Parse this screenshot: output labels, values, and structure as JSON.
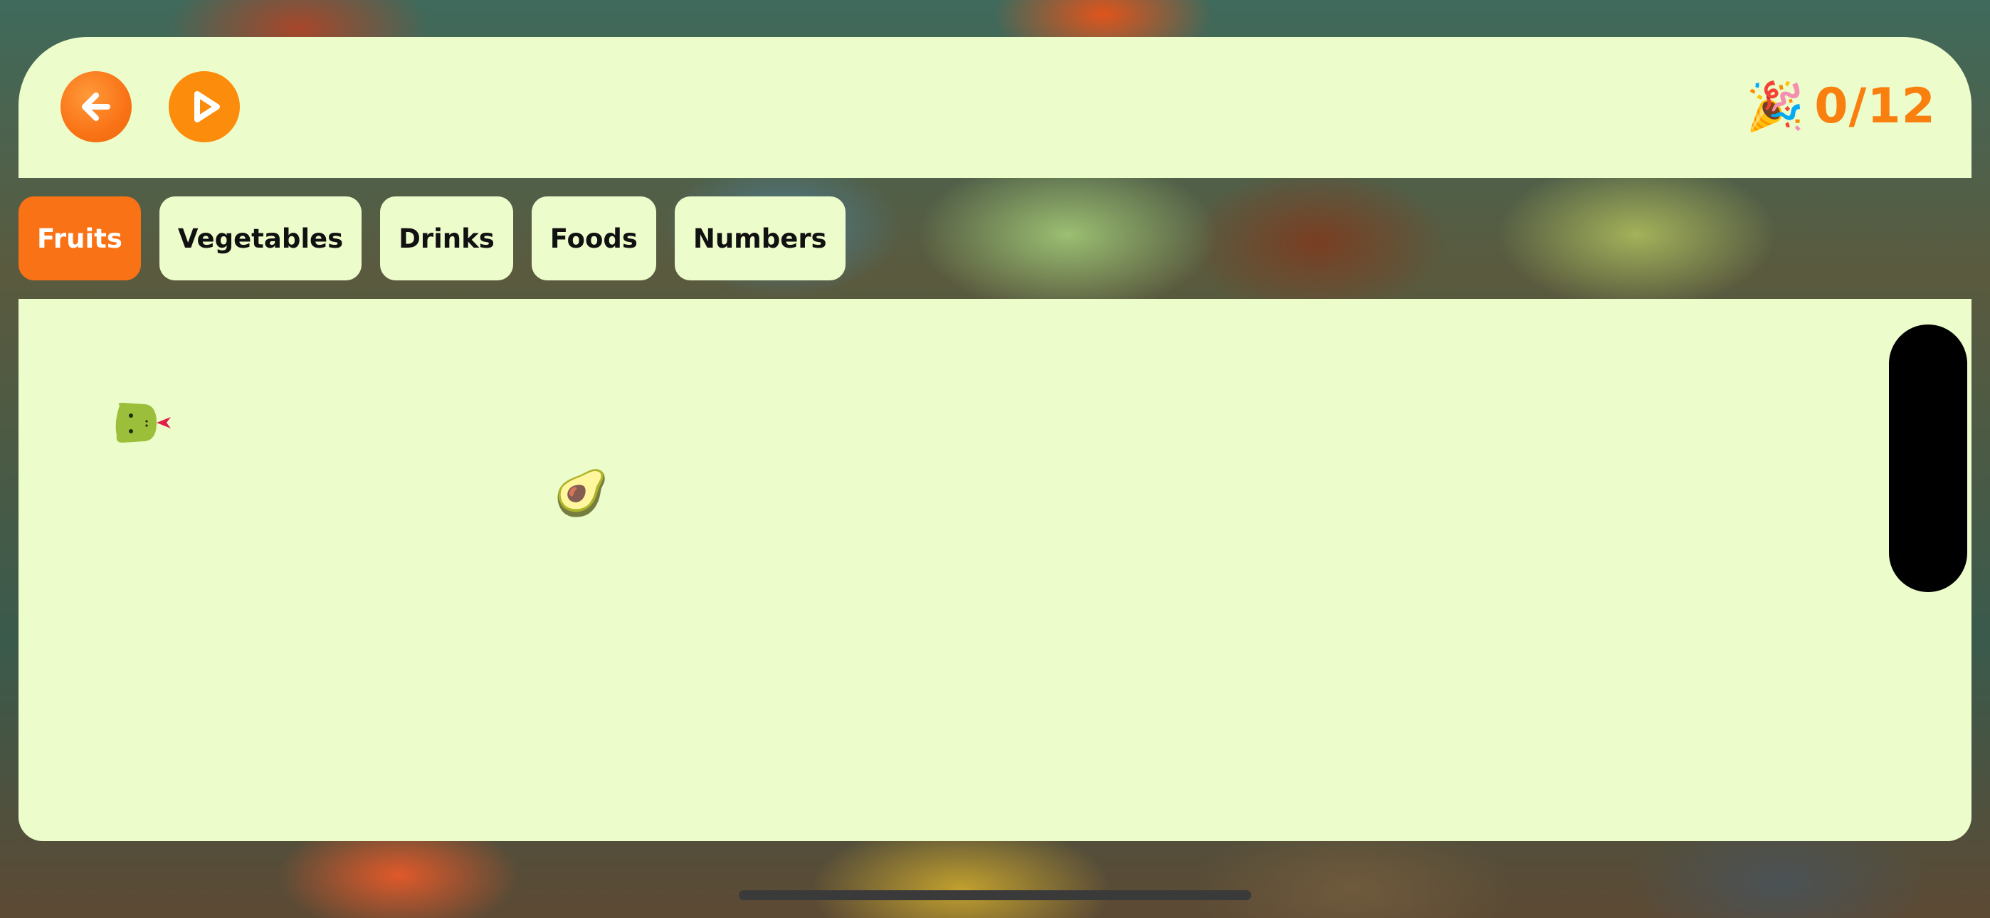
{
  "header": {
    "back_icon": "arrow-left-icon",
    "play_icon": "play-icon",
    "score": {
      "emoji": "🎉",
      "text": "0/12"
    }
  },
  "tabs": [
    {
      "label": "Fruits",
      "active": true
    },
    {
      "label": "Vegetables",
      "active": false
    },
    {
      "label": "Drinks",
      "active": false
    },
    {
      "label": "Foods",
      "active": false
    },
    {
      "label": "Numbers",
      "active": false
    }
  ],
  "board": {
    "food_emoji": "🥑",
    "snake_color": "#9bbf3a",
    "tongue_color": "#e11d48"
  },
  "colors": {
    "accent": "#f97316",
    "panel": "#ecfccb",
    "score": "#f97f0f"
  }
}
